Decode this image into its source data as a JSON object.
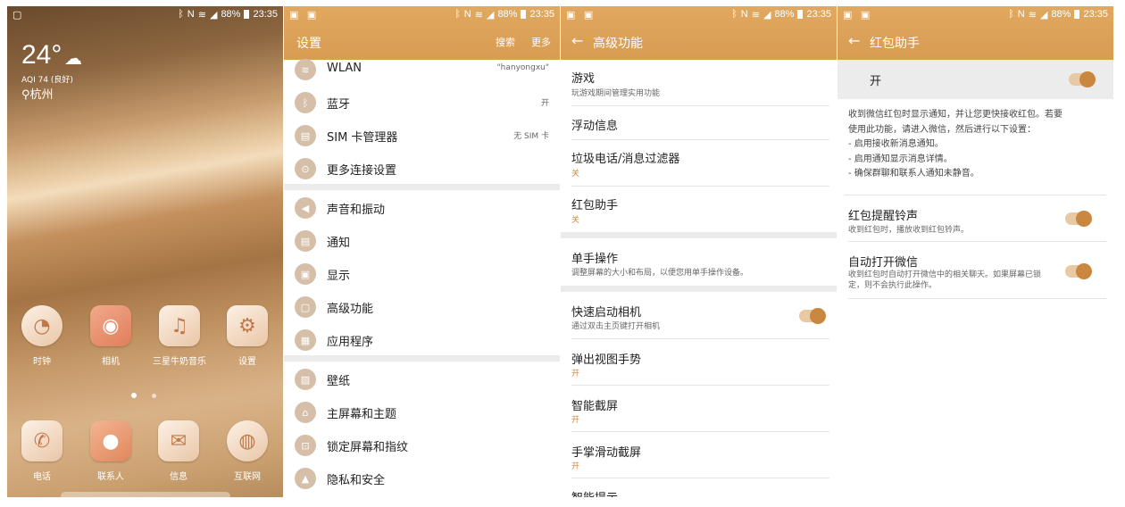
{
  "status": {
    "time": "23:35",
    "battery": "88%",
    "icons": [
      "bluetooth-icon",
      "nfc-icon",
      "wifi-icon",
      "signal-icon",
      "battery-icon"
    ]
  },
  "home": {
    "temperature": "24°",
    "aqi": "AQI 74 (良好)",
    "city": "杭州",
    "apps_row1": [
      {
        "label": "时钟",
        "icon": "clock-icon",
        "glyph": "◔"
      },
      {
        "label": "相机",
        "icon": "camera-icon",
        "glyph": "◉"
      },
      {
        "label": "三星牛奶音乐",
        "icon": "music-icon",
        "glyph": "♫"
      },
      {
        "label": "设置",
        "icon": "settings-gear-icon",
        "glyph": "⚙"
      }
    ],
    "dock": [
      {
        "label": "电话",
        "icon": "phone-icon",
        "glyph": "✆"
      },
      {
        "label": "联系人",
        "icon": "contacts-icon",
        "glyph": "👤"
      },
      {
        "label": "信息",
        "icon": "messages-icon",
        "glyph": "✉"
      },
      {
        "label": "互联网",
        "icon": "browser-icon",
        "glyph": "◍"
      }
    ]
  },
  "settings": {
    "title": "设置",
    "search": "搜索",
    "more": "更多",
    "items": [
      {
        "label": "WLAN",
        "value": "\"hanyongxu\"",
        "icon": "wifi-icon",
        "glyph": "≋"
      },
      {
        "label": "蓝牙",
        "value": "开",
        "icon": "bluetooth-icon",
        "glyph": "ᛒ"
      },
      {
        "label": "SIM 卡管理器",
        "value": "无 SIM 卡",
        "icon": "sim-card-icon",
        "glyph": "▤"
      },
      {
        "label": "更多连接设置",
        "value": "",
        "icon": "connections-icon",
        "glyph": "((•))"
      },
      {
        "label": "声音和振动",
        "value": "",
        "icon": "sound-icon",
        "glyph": "◀)"
      },
      {
        "label": "通知",
        "value": "",
        "icon": "notification-icon",
        "glyph": "▤"
      },
      {
        "label": "显示",
        "value": "",
        "icon": "display-icon",
        "glyph": "▣"
      },
      {
        "label": "高级功能",
        "value": "",
        "icon": "advanced-icon",
        "glyph": "▢"
      },
      {
        "label": "应用程序",
        "value": "",
        "icon": "apps-icon",
        "glyph": "▦"
      },
      {
        "label": "壁纸",
        "value": "",
        "icon": "wallpaper-icon",
        "glyph": "▨"
      },
      {
        "label": "主屏幕和主题",
        "value": "",
        "icon": "theme-icon",
        "glyph": "⌂"
      },
      {
        "label": "锁定屏幕和指纹",
        "value": "",
        "icon": "lock-icon",
        "glyph": "🔒"
      },
      {
        "label": "隐私和安全",
        "value": "",
        "icon": "privacy-icon",
        "glyph": "▲"
      }
    ]
  },
  "advanced": {
    "title": "高级功能",
    "items": [
      {
        "title": "游戏",
        "sub": "玩游戏期间管理实用功能",
        "state": ""
      },
      {
        "title": "浮动信息",
        "sub": "",
        "state": ""
      },
      {
        "title": "垃圾电话/消息过滤器",
        "sub": "",
        "state": "关"
      },
      {
        "title": "红包助手",
        "sub": "",
        "state": "关"
      },
      {
        "title": "单手操作",
        "sub": "调整屏幕的大小和布局，以便您用单手操作设备。",
        "state": ""
      },
      {
        "title": "快速启动相机",
        "sub": "通过双击主页键打开相机",
        "state": ""
      },
      {
        "title": "弹出视图手势",
        "sub": "",
        "state": "开"
      },
      {
        "title": "智能截屏",
        "sub": "",
        "state": "开"
      },
      {
        "title": "手掌滑动截屏",
        "sub": "",
        "state": "开"
      },
      {
        "title": "智能提示",
        "sub": "",
        "state": ""
      }
    ]
  },
  "redpacket": {
    "title": "红包助手",
    "master_label": "开",
    "description": [
      "收到微信红包时显示通知，并让您更快接收红包。若要",
      "使用此功能，请进入微信，然后进行以下设置：",
      "- 启用接收新消息通知。",
      "- 启用通知显示消息详情。",
      "- 确保群聊和联系人通知未静音。"
    ],
    "ringtone_title": "红包提醒铃声",
    "ringtone_sub": "收到红包时，播放收到红包铃声。",
    "auto_title": "自动打开微信",
    "auto_sub": [
      "收到红包时自动打开微信中的相关聊天。如果屏幕已锁",
      "定，则不会执行此操作。"
    ]
  }
}
